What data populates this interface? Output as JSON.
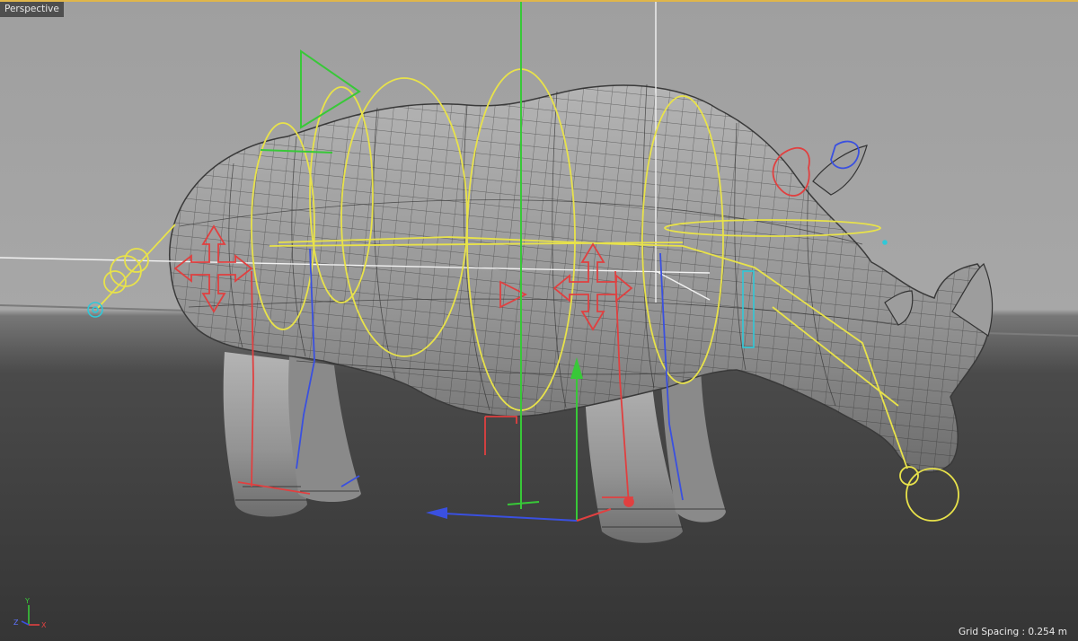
{
  "viewport": {
    "camera_label": "Perspective",
    "grid_spacing_label": "Grid Spacing : 0.254 m"
  },
  "axis_gizmo": {
    "y_label": "Y",
    "x_label": "X",
    "z_label": "Z"
  },
  "colors": {
    "background_top": "#a5a5a5",
    "floor": "#3a3a3a",
    "mesh_fill": "#9a9a9a",
    "wireframe": "#2a2a2a",
    "rig_yellow": "#e8e24a",
    "rig_red": "#e04040",
    "rig_blue": "#3a50e0",
    "rig_green": "#38c838",
    "rig_cyan": "#30c8d8",
    "active_frame": "#e0b64a"
  }
}
